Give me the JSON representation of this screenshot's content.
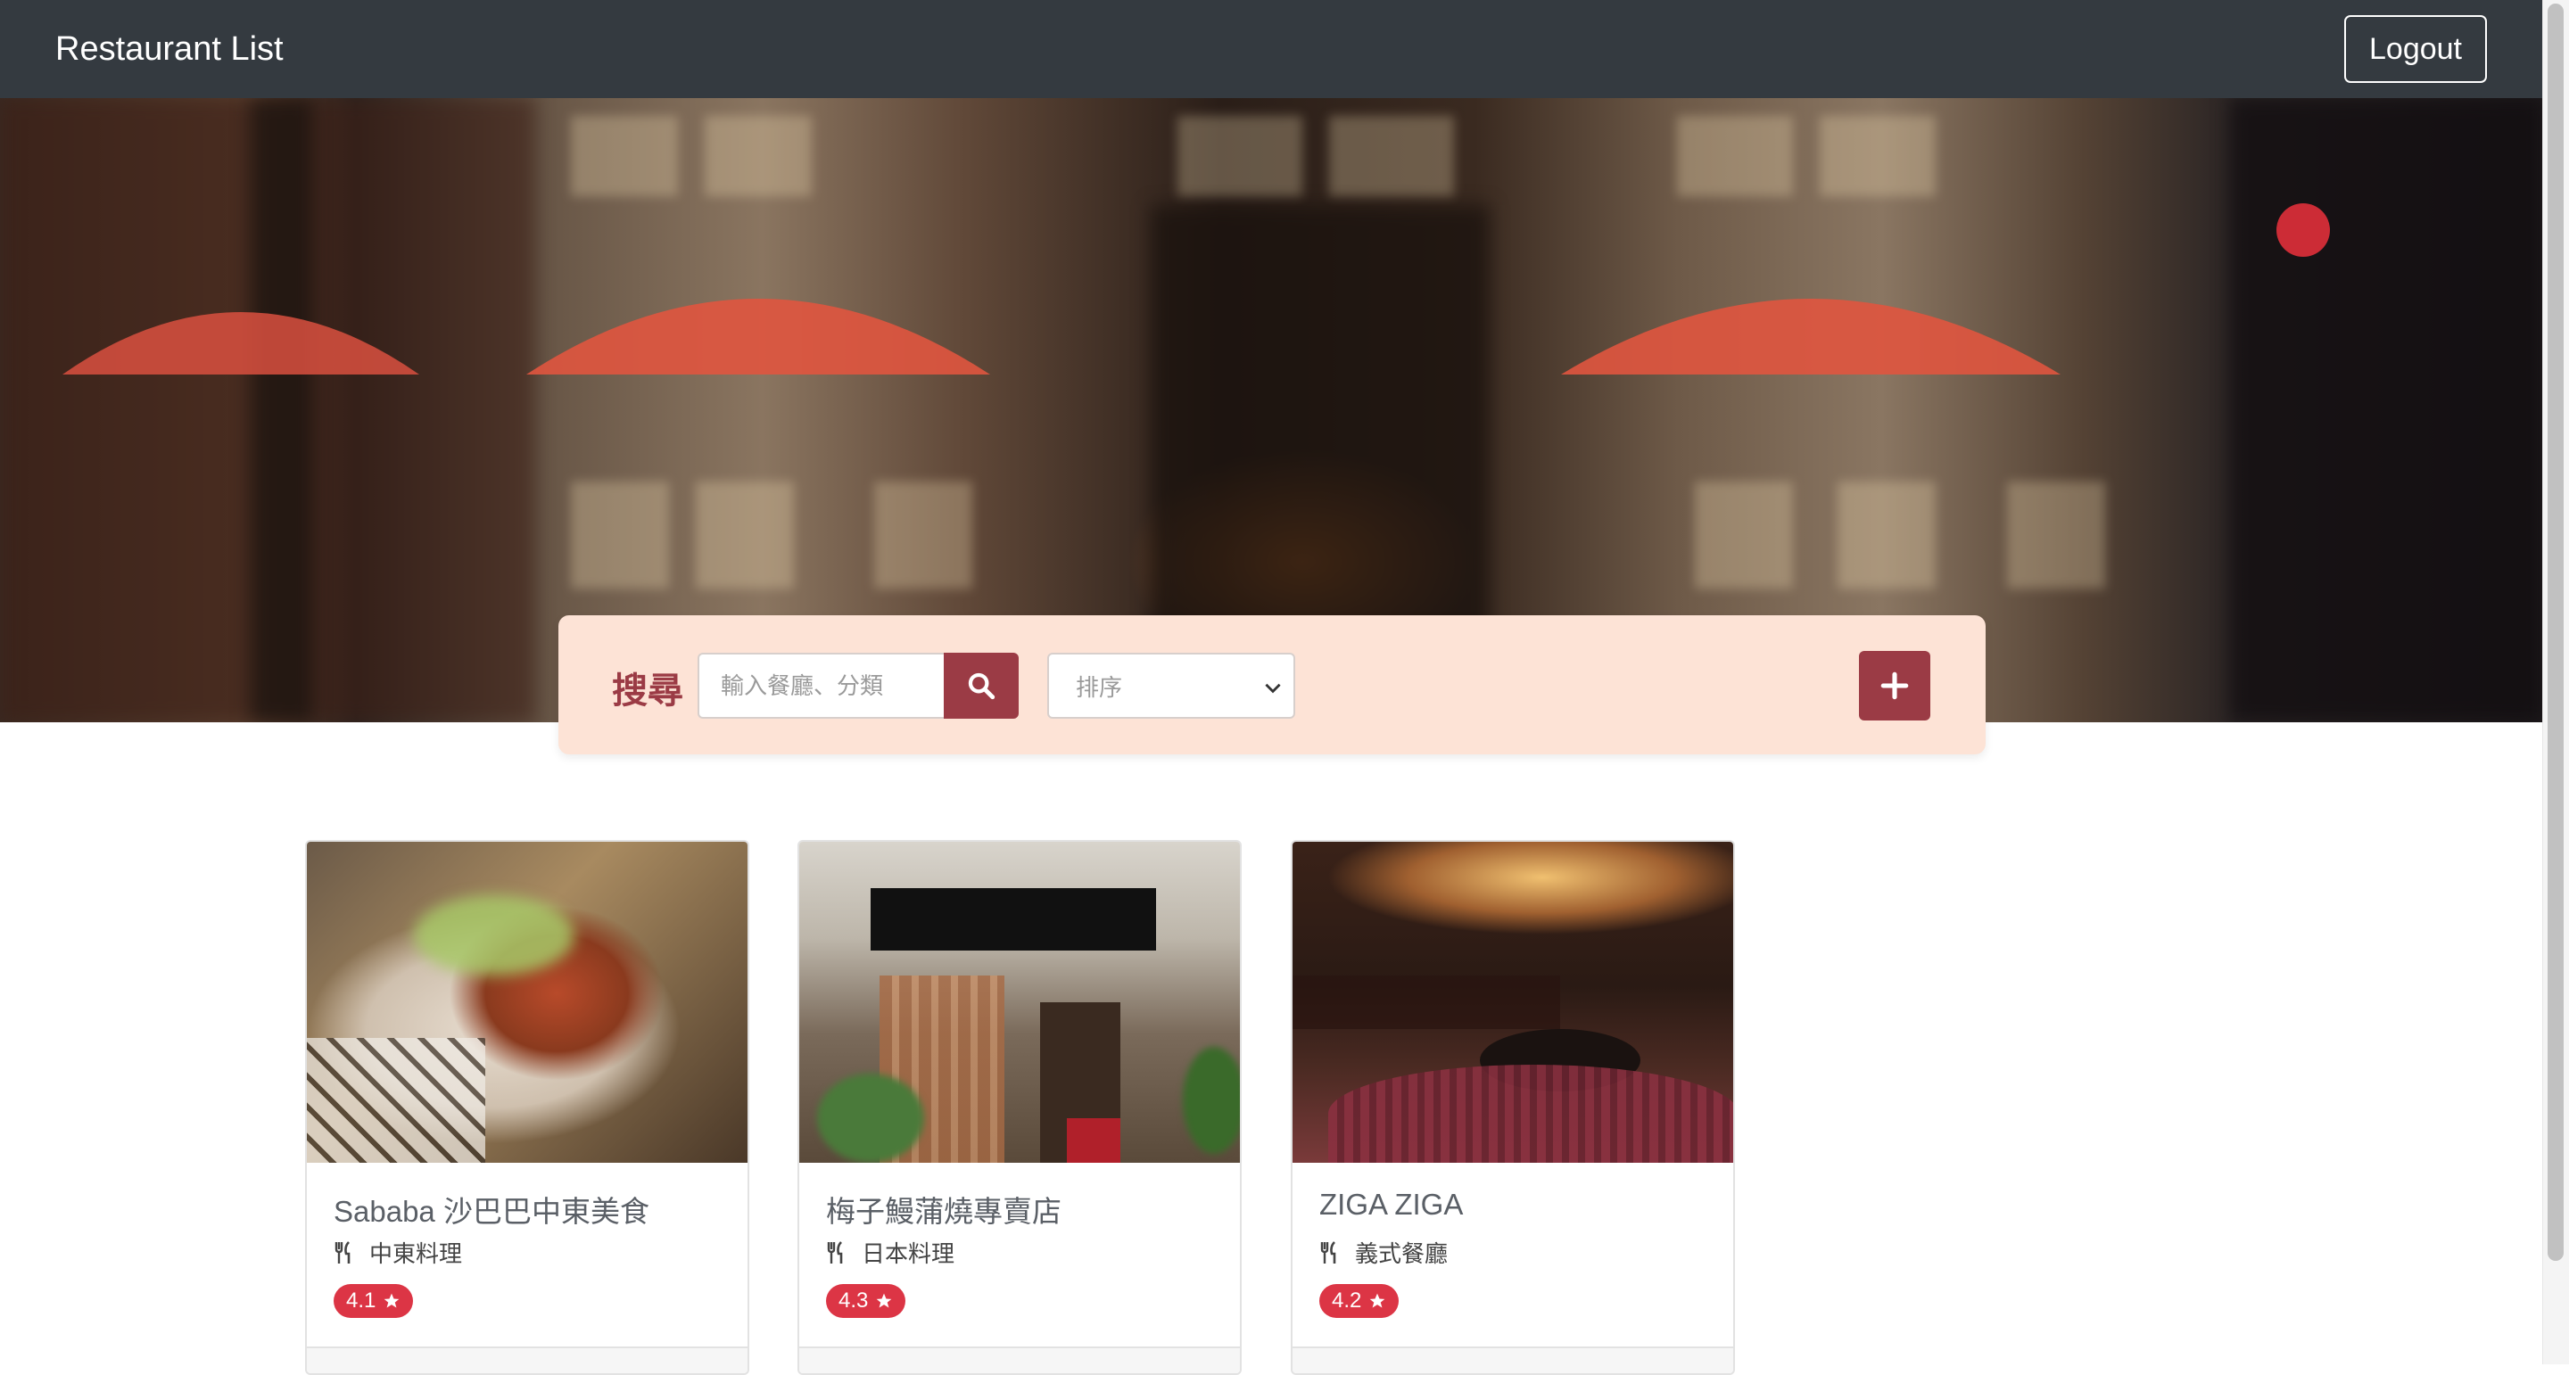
{
  "navbar": {
    "brand": "Restaurant List",
    "logout_label": "Logout"
  },
  "search": {
    "label": "搜尋",
    "placeholder": "輸入餐廳、分類",
    "sort_placeholder": "排序"
  },
  "restaurants": [
    {
      "name": "Sababa 沙巴巴中東美食",
      "category": "中東料理",
      "rating": "4.1"
    },
    {
      "name": "梅子鰻蒲燒專賣店",
      "category": "日本料理",
      "rating": "4.3"
    },
    {
      "name": "ZIGA ZIGA",
      "category": "義式餐廳",
      "rating": "4.2"
    }
  ],
  "colors": {
    "accent": "#9b3b45",
    "navbar": "#343a40",
    "search_bg": "#fde3d6",
    "badge": "#dc3545"
  },
  "icons": [
    "search-icon",
    "plus-icon",
    "chevron-down-icon",
    "utensils-icon",
    "star-icon"
  ]
}
